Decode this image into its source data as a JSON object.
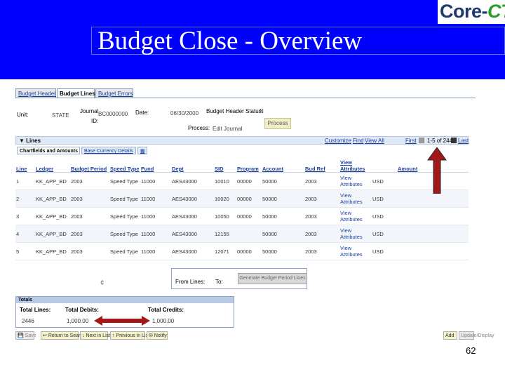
{
  "slide": {
    "title": "Budget Close - Overview",
    "logo": {
      "core": "Core-",
      "ct": "CT"
    },
    "page_number": "62"
  },
  "tabs": [
    {
      "label": "Budget Header",
      "active": false
    },
    {
      "label": "Budget Lines",
      "active": true
    },
    {
      "label": "Budget Errors",
      "active": false
    }
  ],
  "header": {
    "unit_label": "Unit:",
    "unit_value": "STATE",
    "journal_label": "Journal",
    "id_label": "ID:",
    "journal_value": "BC0000000",
    "date_label": "Date:",
    "date_value": "06/30/2000",
    "status_label": "Budget Header Status:",
    "status_value": "N",
    "process_label": "Process:",
    "process_value": "Edit Journal",
    "process_button": "Process"
  },
  "grid": {
    "title": "Lines",
    "customize": "Customize",
    "find": "Find",
    "view_all": "View All",
    "first": "First",
    "range": "1-5 of 2446",
    "last": "Last",
    "sub_tabs": [
      "Chartfields and Amounts",
      "Base Currency Details"
    ],
    "columns": [
      "Line",
      "Ledger",
      "Budget Period",
      "Speed Type",
      "Fund",
      "Dept",
      "SID",
      "Program",
      "Account",
      "Bud Ref",
      "View Attributes",
      "",
      "Amount"
    ],
    "rows": [
      {
        "line": "1",
        "ledger": "KK_APP_BD",
        "period": "2003",
        "speed": "Speed Type",
        "fund": "11000",
        "dept": "AES43000",
        "sid": "10010",
        "program": "00000",
        "account": "50000",
        "budref": "2003",
        "view": "View Attributes",
        "cur": "USD",
        "amount": ""
      },
      {
        "line": "2",
        "ledger": "KK_APP_BD",
        "period": "2003",
        "speed": "Speed Type",
        "fund": "11000",
        "dept": "AES43000",
        "sid": "10020",
        "program": "00000",
        "account": "50000",
        "budref": "2003",
        "view": "View Attributes",
        "cur": "USD",
        "amount": ""
      },
      {
        "line": "3",
        "ledger": "KK_APP_BD",
        "period": "2003",
        "speed": "Speed Type",
        "fund": "11000",
        "dept": "AES43000",
        "sid": "10050",
        "program": "00000",
        "account": "50000",
        "budref": "2003",
        "view": "View Attributes",
        "cur": "USD",
        "amount": ""
      },
      {
        "line": "4",
        "ledger": "KK_APP_BD",
        "period": "2003",
        "speed": "Speed Type",
        "fund": "11000",
        "dept": "AES43000",
        "sid": "12155",
        "program": "",
        "account": "50000",
        "budref": "2003",
        "view": "View Attributes",
        "cur": "USD",
        "amount": ""
      },
      {
        "line": "5",
        "ledger": "KK_APP_BD",
        "period": "2003",
        "speed": "Speed Type",
        "fund": "11000",
        "dept": "AES43000",
        "sid": "12071",
        "program": "00000",
        "account": "50000",
        "budref": "2003",
        "view": "View Attributes",
        "cur": "USD",
        "amount": ""
      }
    ]
  },
  "range_box": {
    "from_label": "From Lines:",
    "to_label": "To:",
    "button": "Generate Budget Period Lines"
  },
  "totals": {
    "header": "Totals",
    "lines_label": "Total Lines:",
    "lines_value": "2446",
    "debits_label": "Total Debits:",
    "debits_value": "1,000.00",
    "credits_label": "Total Credits:",
    "credits_value": "1,000.00"
  },
  "toolbar": {
    "save": "Save",
    "return": "Return to Search",
    "next": "Next in List",
    "previous": "Previous in List",
    "notify": "Notify",
    "add": "Add",
    "update": "Update/Display"
  },
  "colors": {
    "slide_bg": "#0000ff",
    "arrow": "#a01818"
  }
}
